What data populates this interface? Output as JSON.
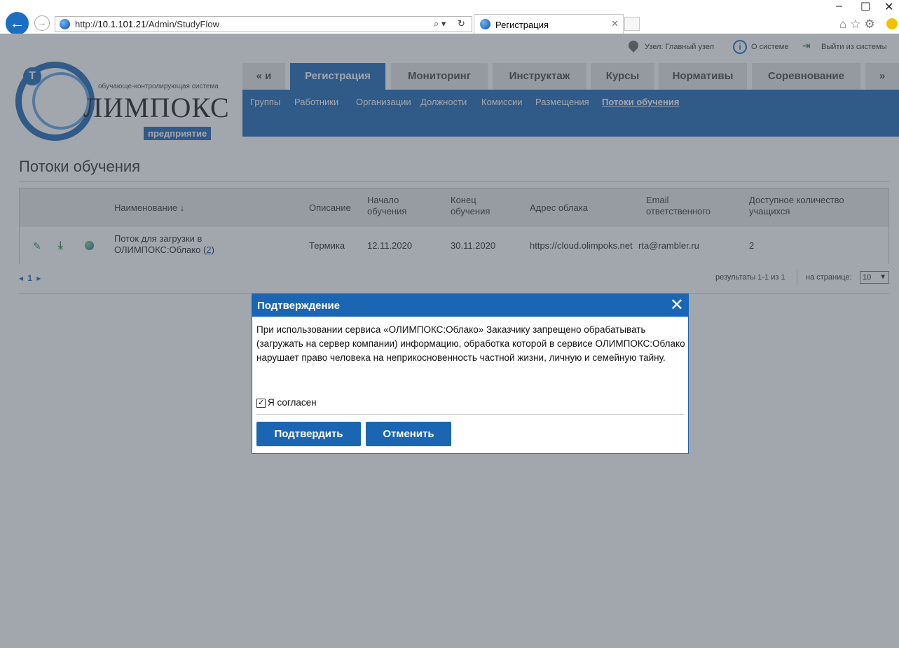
{
  "browser": {
    "url_prefix": "http://",
    "url_host": "10.1.101.21",
    "url_path": "/Admin/StudyFlow",
    "tab_title": "Регистрация",
    "minimize": "–",
    "restore": "☐",
    "close": "✕"
  },
  "topbar": {
    "node_label": "Узел: Главный узел",
    "about_label": "О системе",
    "logout_label": "Выйти из системы"
  },
  "logo": {
    "tagline": "обучающе-контролирующая система",
    "brand": "ЛИМПОКС",
    "subtitle": "предприятие",
    "symbol": "Т"
  },
  "nav": {
    "tabs": [
      {
        "label": "« и"
      },
      {
        "label": "Регистрация"
      },
      {
        "label": "Мониторинг"
      },
      {
        "label": "Инструктаж"
      },
      {
        "label": "Курсы"
      },
      {
        "label": "Нормативы"
      },
      {
        "label": "Соревнование"
      },
      {
        "label": "»"
      }
    ],
    "subtabs": [
      {
        "label": "Группы"
      },
      {
        "label": "Работники"
      },
      {
        "label": "Организации"
      },
      {
        "label": "Должности"
      },
      {
        "label": "Комиссии"
      },
      {
        "label": "Размещения"
      },
      {
        "label": "Потоки обучения"
      }
    ]
  },
  "page": {
    "title": "Потоки обучения"
  },
  "grid": {
    "headers": {
      "name": "Наименование ↓",
      "description": "Описание",
      "start_1": "Начало",
      "start_2": "обучения",
      "end_1": "Конец",
      "end_2": "обучения",
      "cloud": "Адрес облака",
      "email_1": "Email",
      "email_2": "ответственного",
      "count_1": "Доступное количество",
      "count_2": "учащихся"
    },
    "row": {
      "name_1": "Поток для загрузки в",
      "name_2": "ОЛИМПОКС:Облако (",
      "name_count": "2",
      "name_end": ")",
      "description": "Термика",
      "start": "12.11.2020",
      "end": "30.11.2020",
      "cloud": "https://cloud.olimpoks.net",
      "email": "rta@rambler.ru",
      "count": "2"
    }
  },
  "pager": {
    "prev": "◂",
    "page": "1",
    "next": "▸",
    "results": "результаты 1-1 из 1",
    "per_page_label": "на странице:",
    "per_page_value": "10"
  },
  "dialog": {
    "title": "Подтверждение",
    "close": "✕",
    "text": "При использовании сервиса «ОЛИМПОКС:Облако» Заказчику запрещено обрабатывать (загружать на сервер компании) информацию, обработка которой в сервисе ОЛИМПОКС:Облако нарушает право человека на неприкосновенность частной жизни, личную и семейную тайну.",
    "checkbox_label": "Я согласен",
    "checked": "✓",
    "confirm": "Подтвердить",
    "cancel": "Отменить"
  },
  "colors": {
    "brand_blue": "#1b66b3",
    "icon_green": "#2a8e4b"
  }
}
